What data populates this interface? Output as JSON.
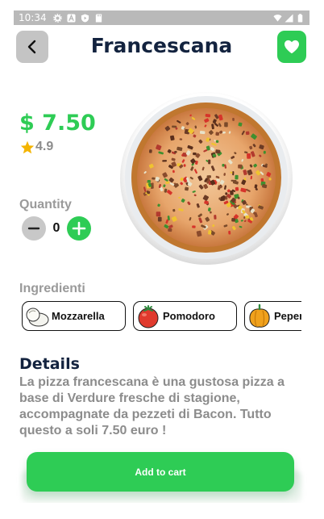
{
  "status_bar": {
    "time": "10:34",
    "left_icons": [
      "settings-icon",
      "a-icon",
      "shield-play-icon",
      "sd-card-icon"
    ],
    "right_icons": [
      "wifi-icon",
      "signal-icon",
      "battery-icon"
    ]
  },
  "header": {
    "title": "Francescana",
    "back_icon": "chevron-left-icon",
    "favorite_icon": "heart-icon"
  },
  "product": {
    "price": "$ 7.50",
    "rating": "4.9"
  },
  "quantity": {
    "label": "Quantity",
    "value": "0"
  },
  "ingredients": {
    "label": "Ingredienti",
    "items": [
      {
        "name": "Mozzarella",
        "icon": "mozzarella-icon"
      },
      {
        "name": "Pomodoro",
        "icon": "tomato-icon"
      },
      {
        "name": "Peperoni",
        "icon": "pepper-icon"
      }
    ]
  },
  "details": {
    "title": "Details",
    "text": "La pizza francescana è una gustosa pizza a base di Verdure fresche di stagione, accompagnate da pezzeti di Bacon. Tutto questo a soli 7.50 euro !"
  },
  "cart": {
    "label": "Add to cart"
  },
  "colors": {
    "accent": "#2ecc55",
    "title": "#13233f",
    "muted": "#8c8c8c",
    "status_bar": "#b9b9b9"
  }
}
